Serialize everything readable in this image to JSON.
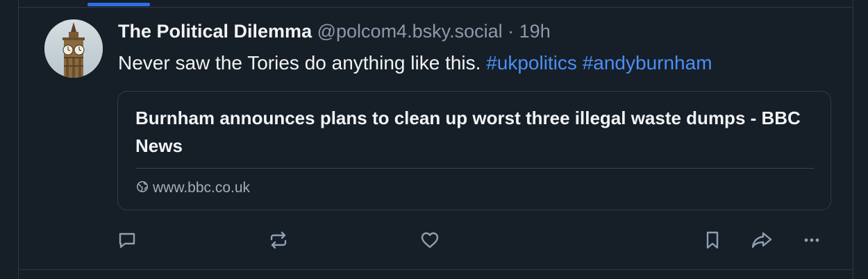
{
  "post": {
    "author": {
      "display_name": "The Political Dilemma",
      "handle": "@polcom4.bsky.social",
      "separator": "·",
      "time_ago": "19h"
    },
    "text": {
      "body": "Never saw the Tories do anything like this. ",
      "hashtags": [
        "#ukpolitics",
        "#andyburnham"
      ]
    },
    "embed": {
      "title": "Burnham announces plans to clean up worst three illegal waste dumps - BBC News",
      "domain": "www.bbc.co.uk",
      "domain_icon": "globe-icon"
    },
    "actions": [
      {
        "name": "reply",
        "icon": "speech-bubble-icon"
      },
      {
        "name": "repost",
        "icon": "repost-icon"
      },
      {
        "name": "like",
        "icon": "heart-icon"
      },
      {
        "name": "bookmark",
        "icon": "bookmark-icon"
      },
      {
        "name": "share",
        "icon": "share-arrow-icon"
      },
      {
        "name": "more",
        "icon": "ellipsis-icon"
      }
    ]
  },
  "colors": {
    "background": "#161e27",
    "border": "#2e3948",
    "accent": "#2d6ee6",
    "hashtag": "#4b8ff7",
    "primary_text": "#f1f3f5",
    "secondary_text": "#8c9aab"
  }
}
